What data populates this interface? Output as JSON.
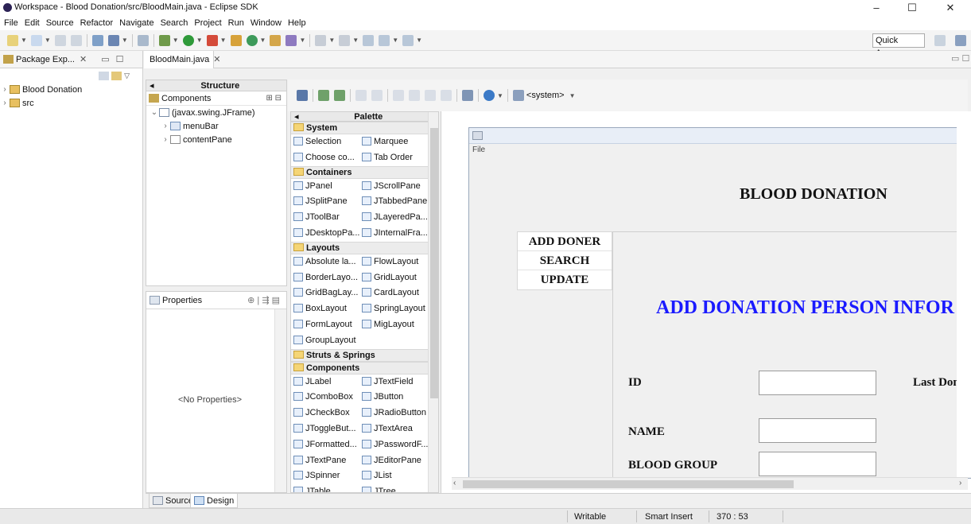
{
  "window": {
    "title": "Workspace - Blood Donation/src/BloodMain.java - Eclipse SDK",
    "minimize": "–",
    "maximize": "☐",
    "close": "✕"
  },
  "menubar": [
    "File",
    "Edit",
    "Source",
    "Refactor",
    "Navigate",
    "Search",
    "Project",
    "Run",
    "Window",
    "Help"
  ],
  "toolbar": {
    "quick_access": "Quick Access"
  },
  "package_explorer": {
    "tab_label": "Package Exp...",
    "items": [
      {
        "label": "Blood Donation",
        "icon": "project-icon"
      },
      {
        "label": "src",
        "icon": "source-folder-icon"
      }
    ]
  },
  "editor": {
    "tab_label": "BloodMain.java"
  },
  "structure": {
    "header": "Structure",
    "components_label": "Components",
    "tree": [
      {
        "label": "(javax.swing.JFrame)",
        "level": 0,
        "expanded": true
      },
      {
        "label": "menuBar",
        "level": 1,
        "expanded": false
      },
      {
        "label": "contentPane",
        "level": 1,
        "expanded": false
      }
    ]
  },
  "properties": {
    "tab_label": "Properties",
    "empty_text": "<No Properties>"
  },
  "design_toolbar": {
    "system_label": "<system>"
  },
  "palette": {
    "header": "Palette",
    "groups": [
      {
        "category": "System",
        "items": [
          "Selection",
          "Marquee",
          "Choose co...",
          "Tab Order"
        ]
      },
      {
        "category": "Containers",
        "items": [
          "JPanel",
          "JScrollPane",
          "JSplitPane",
          "JTabbedPane",
          "JToolBar",
          "JLayeredPa...",
          "JDesktopPa...",
          "JInternalFra..."
        ]
      },
      {
        "category": "Layouts",
        "items": [
          "Absolute la...",
          "FlowLayout",
          "BorderLayo...",
          "GridLayout",
          "GridBagLay...",
          "CardLayout",
          "BoxLayout",
          "SpringLayout",
          "FormLayout",
          "MigLayout",
          "GroupLayout"
        ]
      },
      {
        "category": "Struts & Springs",
        "items": []
      },
      {
        "category": "Components",
        "items": [
          "JLabel",
          "JTextField",
          "JComboBox",
          "JButton",
          "JCheckBox",
          "JRadioButton",
          "JToggleBut...",
          "JTextArea",
          "JFormatted...",
          "JPasswordF...",
          "JTextPane",
          "JEditorPane",
          "JSpinner",
          "JList",
          "JTable",
          "JTree"
        ]
      }
    ]
  },
  "frame": {
    "menu": "File",
    "title": "BLOOD DONATION",
    "nav": [
      "ADD DONER",
      "SEARCH",
      "UPDATE"
    ],
    "form_title": "ADD DONATION PERSON INFOR",
    "fields": {
      "id": "ID",
      "last_donation": "Last Donatio",
      "name": "NAME",
      "blood_group": "BLOOD GROUP"
    }
  },
  "bottom_tabs": {
    "source": "Source",
    "design": "Design"
  },
  "status": {
    "writable": "Writable",
    "insert_mode": "Smart Insert",
    "position": "370 : 53"
  }
}
